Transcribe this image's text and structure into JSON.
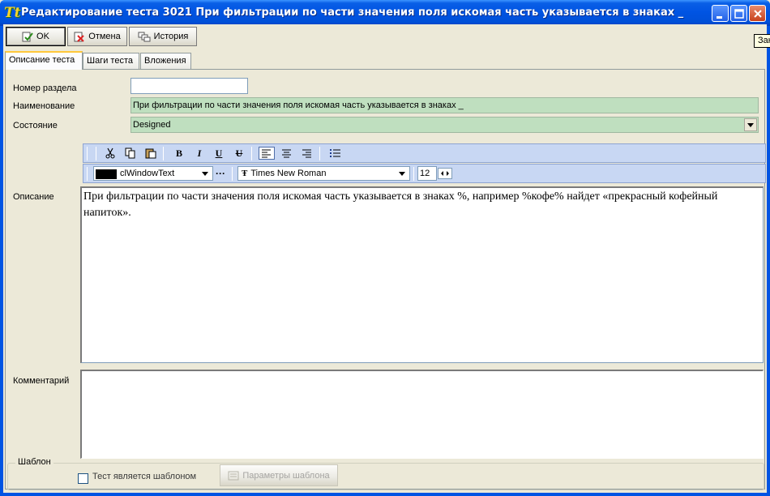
{
  "window": {
    "title": "Редактирование теста 3021 При фильтрации по части значения поля искомая часть указывается в знаках _",
    "app_icon": "Tt"
  },
  "toolbar": {
    "ok_label": "OK",
    "cancel_label": "Отмена",
    "history_label": "История"
  },
  "tooltip": "Зак",
  "tabs": [
    {
      "label": "Описание теста",
      "active": true
    },
    {
      "label": "Шаги теста",
      "active": false
    },
    {
      "label": "Вложения",
      "active": false
    }
  ],
  "form": {
    "section_number_label": "Номер раздела",
    "section_number_value": "",
    "name_label": "Наименование",
    "name_value": "При фильтрации по части значения поля искомая часть указывается в знаках _",
    "state_label": "Состояние",
    "state_value": "Designed",
    "description_label": "Описание",
    "comment_label": "Комментарий",
    "description_text": "При фильтрации по части значения поля искомая часть указывается в знаках %, например %кофе% найдет «прекрасный кофейный напиток».",
    "comment_text": ""
  },
  "richtext": {
    "color_name": "clWindowText",
    "color_swatch": "#000000",
    "more_label": "···",
    "font_name": "Times New Roman",
    "font_size": "12",
    "bold": "B",
    "italic": "I",
    "underline": "U",
    "strike": "U"
  },
  "template": {
    "group_title": "Шаблон",
    "checkbox_label": "Тест является шаблоном",
    "params_button_label": "Параметры шаблона",
    "is_template": false
  },
  "colors": {
    "title_bar": "#0054e3",
    "field_green": "#bfdfbf",
    "rt_toolbar": "#c8d7f3",
    "window_bg": "#ece9d8"
  }
}
